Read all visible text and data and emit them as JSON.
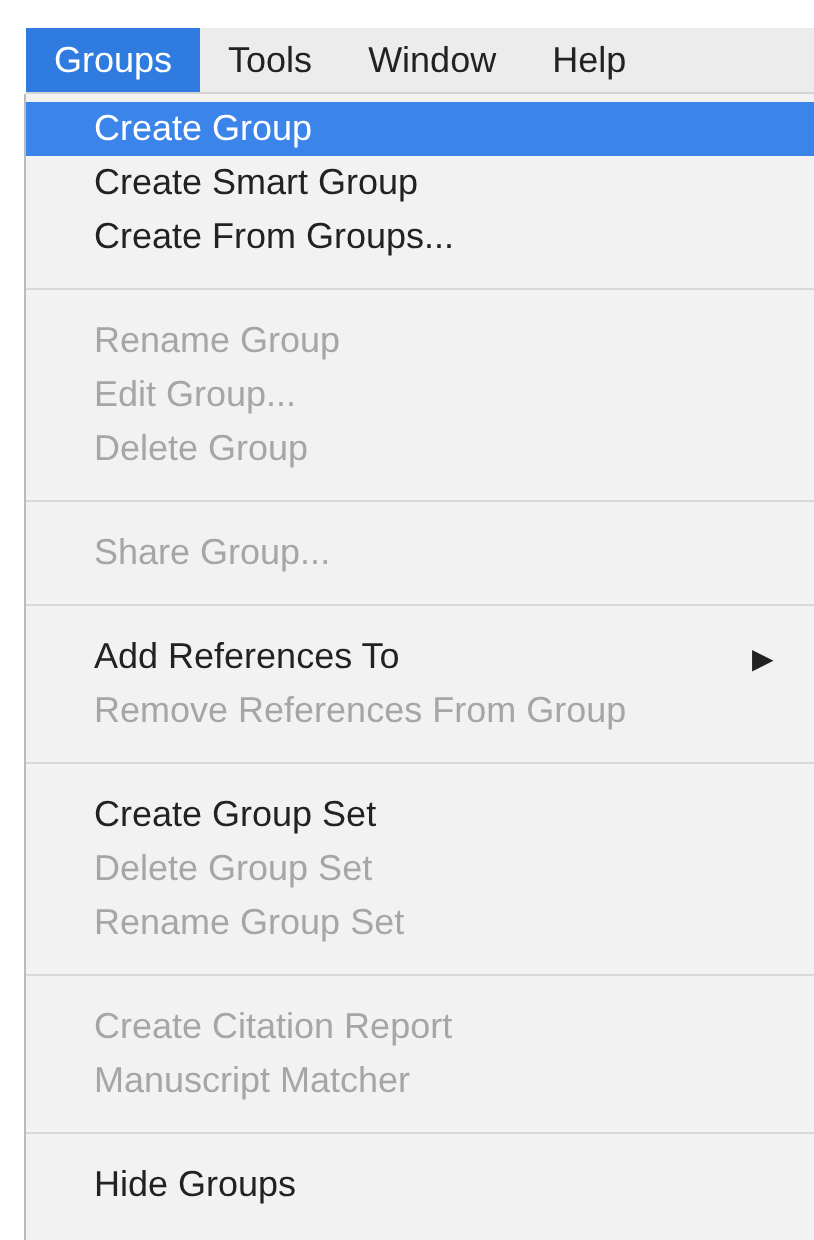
{
  "menu_bar": [
    {
      "label": "Groups",
      "selected": true
    },
    {
      "label": "Tools",
      "selected": false
    },
    {
      "label": "Window",
      "selected": false
    },
    {
      "label": "Help",
      "selected": false
    }
  ],
  "menu": {
    "sections": [
      {
        "items": [
          {
            "label": "Create Group",
            "selected": true,
            "disabled": false
          },
          {
            "label": "Create Smart Group",
            "selected": false,
            "disabled": false
          },
          {
            "label": "Create From Groups...",
            "selected": false,
            "disabled": false
          }
        ]
      },
      {
        "items": [
          {
            "label": "Rename Group",
            "selected": false,
            "disabled": true
          },
          {
            "label": "Edit Group...",
            "selected": false,
            "disabled": true
          },
          {
            "label": "Delete Group",
            "selected": false,
            "disabled": true
          }
        ]
      },
      {
        "items": [
          {
            "label": "Share Group...",
            "selected": false,
            "disabled": true
          }
        ]
      },
      {
        "items": [
          {
            "label": "Add References To",
            "selected": false,
            "disabled": false,
            "submenu_arrow": "▶"
          },
          {
            "label": "Remove References From Group",
            "selected": false,
            "disabled": true
          }
        ]
      },
      {
        "items": [
          {
            "label": "Create Group Set",
            "selected": false,
            "disabled": false
          },
          {
            "label": "Delete Group Set",
            "selected": false,
            "disabled": true
          },
          {
            "label": "Rename Group Set",
            "selected": false,
            "disabled": true
          }
        ]
      },
      {
        "items": [
          {
            "label": "Create Citation Report",
            "selected": false,
            "disabled": true
          },
          {
            "label": "Manuscript Matcher",
            "selected": false,
            "disabled": true
          }
        ]
      },
      {
        "items": [
          {
            "label": "Hide Groups",
            "selected": false,
            "disabled": false
          }
        ]
      }
    ]
  }
}
